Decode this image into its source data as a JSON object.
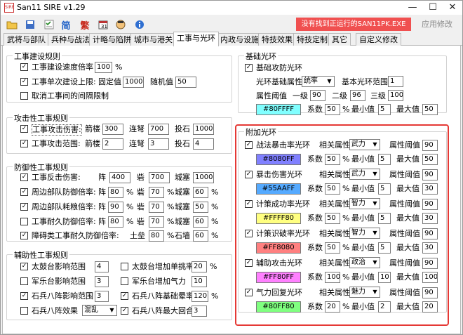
{
  "app": {
    "title": "San11 SIRE v1.29",
    "min_btn": "—",
    "max_btn": "☐",
    "close_btn": "✕"
  },
  "toolbar": {
    "simplified": "简",
    "traditional": "繁",
    "alert": "没有找到正运行的SAN11PK.EXE",
    "apply": "应用修改"
  },
  "tabs": [
    "武将与部队",
    "兵种与战法",
    "计略与陷阱",
    "城市与港关",
    "工事与光环",
    "内政与设施",
    "特技效果",
    "特技定制",
    "其它",
    "自定义修改"
  ],
  "construct": {
    "title": "工事建设规则",
    "speed_label": "工事建设速度倍率",
    "speed_value": "100",
    "pct": "%",
    "limit_label": "工事单次建设上限:",
    "fixed_label": "固定值",
    "fixed_value": "1000",
    "random_label": "随机值",
    "random_value": "50",
    "cancel_label": "取消工事间的间隔限制"
  },
  "attack": {
    "title": "攻击性工事规则",
    "crit_label": "工事攻击伤害:",
    "range_label": "工事攻击范围:",
    "arrow": "箭楼",
    "crossbow": "连弩",
    "catapult": "投石",
    "crit_arrow": "300",
    "crit_crossbow": "700",
    "crit_catapult": "1000",
    "range_arrow": "2",
    "range_crossbow": "3",
    "range_catapult": "4"
  },
  "defense": {
    "title": "防御性工事规则",
    "reflect_label": "工事反击伤害:",
    "camp": "阵",
    "fort": "砦",
    "castle": "城塞",
    "reflect_camp": "400",
    "reflect_fort": "700",
    "reflect_castle": "1000",
    "pct": "%",
    "r1_label": "周边部队防御倍率:",
    "r1": [
      "80",
      "70",
      "60"
    ],
    "r2_label": "周边部队耗粮倍率:",
    "r2": [
      "90",
      "70",
      "50"
    ],
    "r3_label": "工事耐久防御倍率:",
    "r3": [
      "80",
      "70",
      "60"
    ],
    "r4_label": "障碍类工事耐久防御倍率:",
    "earth": "土垒",
    "stone": "石墙",
    "r4": [
      "80",
      "60"
    ]
  },
  "aux": {
    "title": "辅助性工事规则",
    "drum_range": "太鼓台影响范围",
    "drum_range_v": "4",
    "drum_add": "太鼓台增加单挑率",
    "drum_add_v": "20",
    "pct": "%",
    "music_range": "军乐台影响范围",
    "music_range_v": "3",
    "music_add": "军乐台增加气力",
    "music_add_v": "10",
    "stone_range": "石兵八阵影响范围",
    "stone_range_v": "3",
    "stone_base": "石兵八阵基础晕率",
    "stone_base_v": "120",
    "stone_effect": "石兵八阵效果",
    "stone_effect_v": "混乱",
    "stone_max": "石兵八阵最大回合",
    "stone_max_v": "3"
  },
  "base_aura": {
    "title": "基础光环",
    "defense_label": "基础攻防光环",
    "attr_label": "光环基础属性",
    "attr_value": "统率",
    "range_label": "基本光环范围",
    "range_value": "1",
    "threshold_label": "属性阈值",
    "lv1": "一级",
    "lv1_v": "90",
    "lv2": "二级",
    "lv2_v": "96",
    "lv3": "三级",
    "lv3_v": "100",
    "color": "#80FFFF",
    "color_hex": "#80FFFF",
    "coef": "系数",
    "coef_v": "50",
    "pct": "%",
    "min": "最小值",
    "min_v": "5",
    "max": "最大值",
    "max_v": "50"
  },
  "extra_aura": {
    "title": "附加光环",
    "rel_attr": "相关属性",
    "threshold": "属性阈值",
    "coef": "系数",
    "pct": "%",
    "min": "最小值",
    "max": "最大值",
    "items": [
      {
        "name": "战法暴击率光环",
        "attr": "武力",
        "thr": "90",
        "color": "#8080FF",
        "hex": "#8080FF",
        "coef": "50",
        "min": "5",
        "max": "50"
      },
      {
        "name": "暴击伤害光环",
        "attr": "武力",
        "thr": "90",
        "color": "#55AAFF",
        "hex": "#55AAFF",
        "coef": "50",
        "min": "5",
        "max": "30"
      },
      {
        "name": "计策成功率光环",
        "attr": "智力",
        "thr": "90",
        "color": "#FFFF80",
        "hex": "#FFFF80",
        "coef": "50",
        "min": "5",
        "max": "30"
      },
      {
        "name": "计策识破率光环",
        "attr": "智力",
        "thr": "90",
        "color": "#FF8080",
        "hex": "#FF8080",
        "coef": "50",
        "min": "5",
        "max": "30"
      },
      {
        "name": "辅助攻击光环",
        "attr": "政治",
        "thr": "90",
        "color": "#FF80FF",
        "hex": "#FF80FF",
        "coef": "100",
        "min": "10",
        "max": "100"
      },
      {
        "name": "气力回复光环",
        "attr": "魅力",
        "thr": "90",
        "color": "#80FF80",
        "hex": "#80FF80",
        "coef": "20",
        "min": "2",
        "max": "20"
      }
    ]
  },
  "accent": "#e53935"
}
